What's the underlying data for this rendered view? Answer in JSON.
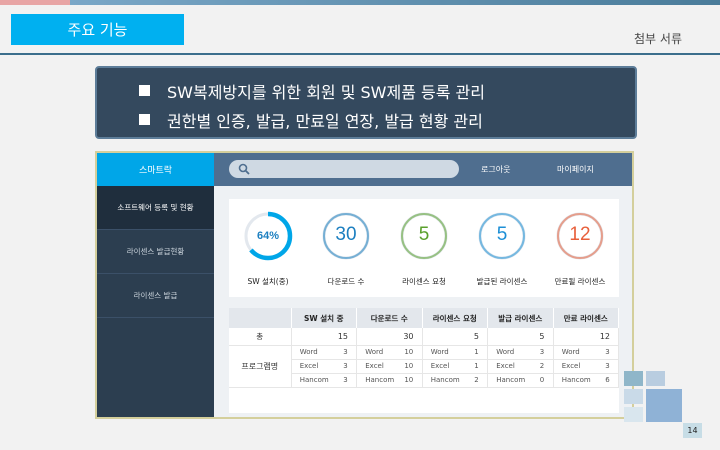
{
  "header": {
    "section_tag": "주요 기능",
    "doc_label": "첨부 서류"
  },
  "banner": {
    "lines": [
      "SW복제방지를 위한 회원 및 SW제품 등록 관리",
      "권한별 인증, 발급, 만료일 연장, 발급 현황 관리"
    ]
  },
  "app": {
    "brand": "스마트락",
    "search_placeholder": "",
    "logout": "로그아웃",
    "mypage": "마이페이지",
    "sidebar": [
      {
        "label": "소프트웨어 등록 및 현황",
        "active": true
      },
      {
        "label": "라이센스 발급현황",
        "active": false
      },
      {
        "label": "라이센스 발급",
        "active": false
      }
    ],
    "stats": [
      {
        "value": "64%",
        "label": "SW 설치(중)",
        "color": "#00a6e8",
        "progress": 0.64
      },
      {
        "value": "30",
        "label": "다운로드 수",
        "color": "#1c7fc0",
        "progress": 1
      },
      {
        "value": "5",
        "label": "라이센스 요청",
        "color": "#5aa02c",
        "progress": 1
      },
      {
        "value": "5",
        "label": "발급된 라이센스",
        "color": "#1c8fd6",
        "progress": 1
      },
      {
        "value": "12",
        "label": "만료될 라이센스",
        "color": "#e8603c",
        "progress": 1
      }
    ],
    "table": {
      "headers": [
        "",
        "SW 설치 중",
        "다운로드 수",
        "라이센스 요청",
        "발급 라이센스",
        "만료 라이센스"
      ],
      "total_label": "총",
      "totals": [
        "15",
        "30",
        "5",
        "5",
        "12"
      ],
      "program_label": "프로그램명",
      "rows": [
        [
          [
            "Word",
            "3"
          ],
          [
            "Word",
            "10"
          ],
          [
            "Word",
            "1"
          ],
          [
            "Word",
            "3"
          ],
          [
            "Word",
            "3"
          ]
        ],
        [
          [
            "Excel",
            "3"
          ],
          [
            "Excel",
            "10"
          ],
          [
            "Excel",
            "1"
          ],
          [
            "Excel",
            "2"
          ],
          [
            "Excel",
            "3"
          ]
        ],
        [
          [
            "Hancom",
            "3"
          ],
          [
            "Hancom",
            "10"
          ],
          [
            "Hancom",
            "2"
          ],
          [
            "Hancom",
            "0"
          ],
          [
            "Hancom",
            "6"
          ]
        ]
      ]
    }
  },
  "page_number": "14"
}
